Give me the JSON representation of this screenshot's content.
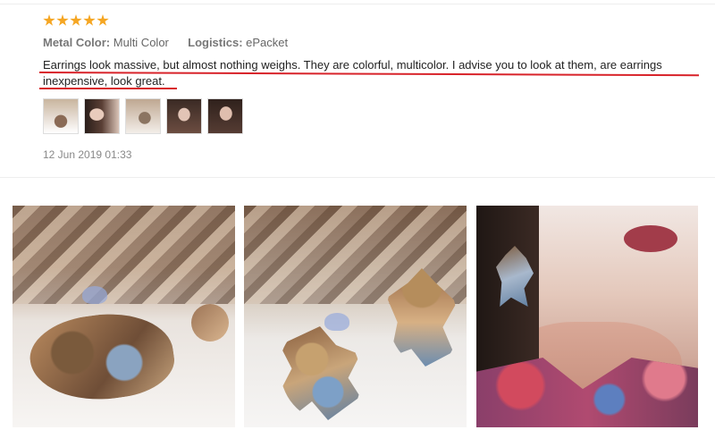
{
  "review": {
    "rating": 5,
    "metal_color_label": "Metal Color:",
    "metal_color_value": "Multi Color",
    "logistics_label": "Logistics:",
    "logistics_value": "ePacket",
    "text": "Earrings look massive, but almost nothing weighs. They are colorful, multicolor. I advise you to look at them, are earrings inexpensive, look great.",
    "date": "12 Jun 2019 01:33",
    "thumbnail_count": 5
  },
  "colors": {
    "star": "#f5a623",
    "underline": "#d8232a",
    "text": "#222222",
    "meta": "#666666",
    "date": "#888888"
  },
  "icons": [
    "star-icon"
  ]
}
